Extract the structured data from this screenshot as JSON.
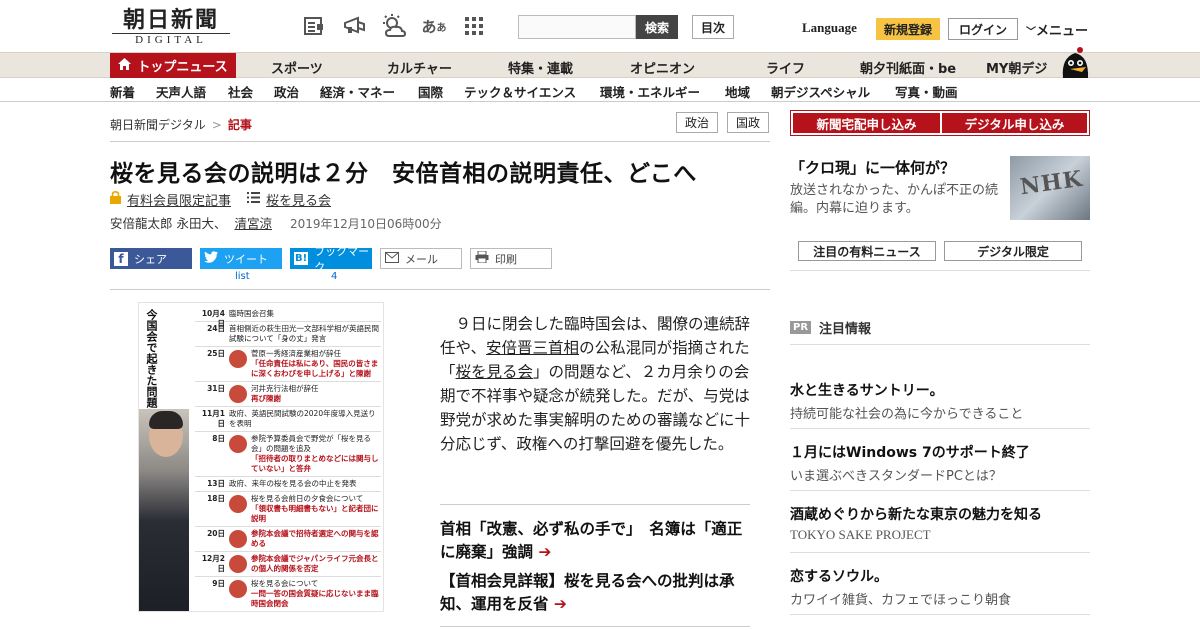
{
  "header": {
    "logo_jp": "朝日新聞",
    "logo_en": "DIGITAL",
    "search_button": "検索",
    "toc_button": "目次",
    "language": "Language",
    "signup": "新規登録",
    "login": "ログイン",
    "menu": "メニュー"
  },
  "nav_primary": [
    "トップニュース",
    "スポーツ",
    "カルチャー",
    "特集・連載",
    "オピニオン",
    "ライフ",
    "朝夕刊紙面・be",
    "MY朝デジ"
  ],
  "nav_secondary": [
    "新着",
    "天声人語",
    "社会",
    "政治",
    "経済・マネー",
    "国際",
    "テック＆サイエンス",
    "環境・エネルギー",
    "地域",
    "朝デジスペシャル",
    "写真・動画"
  ],
  "breadcrumb": {
    "home": "朝日新聞デジタル",
    "sep": ">",
    "current": "記事"
  },
  "tags": [
    "政治",
    "国政"
  ],
  "article": {
    "title": "桜を見る会の説明は２分　安倍首相の説明責任、どこへ",
    "members_only": "有料会員限定記事",
    "series": "桜を見る会",
    "authors": "安倍龍太郎 永田大、",
    "author_link": "清宮涼",
    "date": "2019年12月10日06時00分",
    "body_1": "９日に閉会した臨時国会は、閣僚の連続辞任や、",
    "body_link1": "安倍晋三首相",
    "body_2": "の公私混同が指摘された「",
    "body_link2": "桜を見る会",
    "body_3": "」の問題など、２カ月余りの会期で不祥事や疑念が続発した。だが、与党は野党が求めた事実解明のための審議などに十分応じず、政権への打撃回避を優先した。",
    "related_1": "首相「改憲、必ず私の手で」　名簿は「適正に廃棄」強調",
    "related_2": "【首相会見詳報】桜を見る会への批判は承知、運用を反省"
  },
  "share": {
    "facebook": "シェア",
    "twitter": "ツイート",
    "twitter_count": "list",
    "hatena": "ブックマーク",
    "hatena_count": "4",
    "mail": "メール",
    "print": "印刷"
  },
  "figure": {
    "title": "今国会で起きた問題と安倍三首相の対応",
    "rows": [
      {
        "date": "10月4日",
        "text": "臨時国会召集",
        "emph": ""
      },
      {
        "date": "24日",
        "text": "首相側近の萩生田光一文部科学相が英語民間試験について「身の丈」発言",
        "emph": ""
      },
      {
        "date": "25日",
        "text": "菅原一秀経済産業相が辞任",
        "emph": "「任命責任は私にあり、国民の皆さまに深くおわびを申し上げる」と陳謝"
      },
      {
        "date": "31日",
        "text": "河井克行法相が辞任",
        "emph": "再び陳謝"
      },
      {
        "date": "11月1日",
        "text": "政府、英語民間試験の2020年度導入見送りを表明",
        "emph": ""
      },
      {
        "date": "8日",
        "text": "参院予算委員会で野党が「桜を見る会」の問題を追及",
        "emph": "「招待者の取りまとめなどには関与していない」と答弁"
      },
      {
        "date": "13日",
        "text": "政府、来年の桜を見る会の中止を発表",
        "emph": ""
      },
      {
        "date": "18日",
        "text": "桜を見る会前日の夕食会について",
        "emph": "「領収書も明細書もない」と記者団に説明"
      },
      {
        "date": "20日",
        "text": "",
        "emph": "参院本会議で招待者選定への関与を認める"
      },
      {
        "date": "12月2日",
        "text": "",
        "emph": "参院本会議でジャパンライフ元会長との個人的関係を否定"
      },
      {
        "date": "9日",
        "text": "桜を見る会について",
        "emph": "一問一答の国会質疑に応じないまま臨時国会閉会"
      }
    ]
  },
  "right": {
    "btn_delivery": "新聞宅配申し込み",
    "btn_digital": "デジタル申し込み",
    "promo_title": "「クロ現」に一体何が？",
    "promo_desc": "放送されなかった、かんぽ不正の続編。内幕に迫ります。",
    "promo_img_text": "NHK",
    "tab_paid": "注目の有料ニュース",
    "tab_digital": "デジタル限定",
    "pr_badge": "PR",
    "pr_title": "注目情報",
    "ads": [
      {
        "title": "水と生きるサントリー。",
        "sub": "持続可能な社会の為に今からできること"
      },
      {
        "title": "１月にはWindows 7のサポート終了",
        "sub": "いま選ぶべきスタンダードPCとは？"
      },
      {
        "title": "酒蔵めぐりから新たな東京の魅力を知る",
        "sub": "TOKYO SAKE PROJECT"
      },
      {
        "title": "恋するソウル。",
        "sub": "カワイイ雑貨、カフェでほっこり朝食"
      }
    ]
  },
  "colors": {
    "brand_red": "#b5121b",
    "signup_yellow": "#f6c343",
    "facebook": "#3b5998",
    "twitter": "#1da1f2",
    "hatena": "#008fde"
  }
}
